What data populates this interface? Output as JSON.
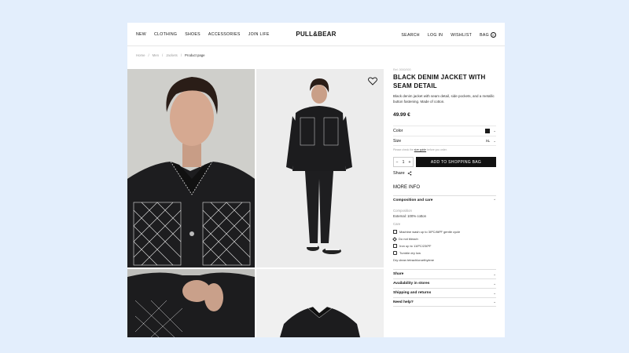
{
  "header": {
    "nav_left": [
      "NEW",
      "CLOTHING",
      "SHOES",
      "ACCESSORIES",
      "JOIN LIFE"
    ],
    "logo": "PULL&BEAR",
    "nav_right": [
      "SEARCH",
      "LOG IN",
      "WISHLIST",
      "BAG"
    ],
    "bag_count": "0"
  },
  "breadcrumb": [
    "Home",
    "Men",
    "Jackets",
    "Product page"
  ],
  "product": {
    "ref": "Ref. 0000/000",
    "title": "BLACK DENIM JACKET WITH SEAM DETAIL",
    "description": "Black denim jacket with seam detail, side pockets, and a metallic button fastening. Made of cotton.",
    "price": "49.99 €",
    "color_label": "Color",
    "color_swatch": "#1a1a1a",
    "size_label": "Size",
    "size_value": "XL",
    "size_hint_prefix": "Please check the",
    "size_hint_link": "size guide",
    "size_hint_suffix": "before you order.",
    "quantity": "1",
    "qty_minus": "−",
    "qty_plus": "+",
    "add_button": "ADD TO SHOPPING BAG",
    "share_label": "Share"
  },
  "more_info": {
    "heading": "MORE INFO",
    "composition_title": "Composition and care",
    "composition_sub": "Composition",
    "composition_value": "External: 100% cotton",
    "care_sub": "Care",
    "care_items": [
      "Machine wash up to 30ºC/86ºF gentle cycle",
      "Do not bleach",
      "Iron up to 110ºC/230ºF",
      "Tumble dry low",
      "Dry clean tetrachloroethylene"
    ],
    "sections": [
      "Share",
      "Availability in stores",
      "Shipping and returns",
      "Need help?"
    ]
  }
}
